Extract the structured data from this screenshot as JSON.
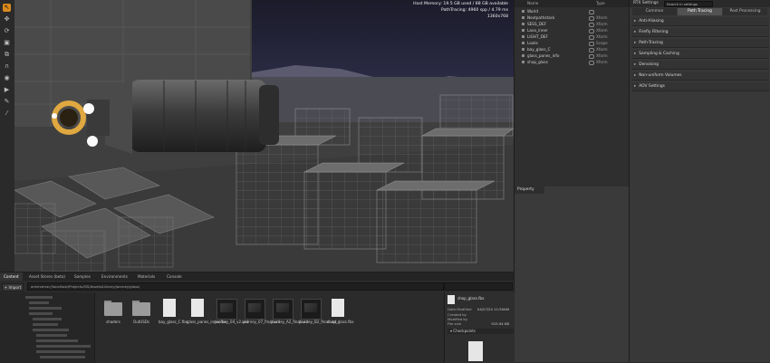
{
  "toolbar": {
    "tools": [
      {
        "name": "select-tool-icon",
        "glyph": "↖",
        "active": true
      },
      {
        "name": "move-tool-icon",
        "glyph": "✥",
        "active": false
      },
      {
        "name": "rotate-tool-icon",
        "glyph": "⟳",
        "active": false
      },
      {
        "name": "scale-tool-icon",
        "glyph": "▣",
        "active": false
      },
      {
        "name": "snap-tool-icon",
        "glyph": "⧉",
        "active": false
      },
      {
        "name": "magnet-tool-icon",
        "glyph": "∩",
        "active": false
      },
      {
        "name": "camera-tool-icon",
        "glyph": "◉",
        "active": false
      },
      {
        "name": "play-tool-icon",
        "glyph": "▶",
        "active": false
      },
      {
        "name": "paint-tool-icon",
        "glyph": "✎",
        "active": false
      },
      {
        "name": "brush-tool-icon",
        "glyph": "⁄",
        "active": false
      }
    ]
  },
  "viewport": {
    "hud_line1": "Host Memory: 19.5 GB used / 88 GB available",
    "hud_line2": "PathTracing: 4960 spp / 4.79 ms",
    "hud_line3": "1360x768"
  },
  "stage": {
    "col_name": "Name",
    "col_type": "Type",
    "rows": [
      {
        "name": "World",
        "type": ""
      },
      {
        "name": "Nextpathstack",
        "type": "Xform"
      },
      {
        "name": "SESS_DEF",
        "type": "Xform"
      },
      {
        "name": "Lava_inner",
        "type": "Xform"
      },
      {
        "name": "LIGHT_DEF",
        "type": "Xform"
      },
      {
        "name": "Looks",
        "type": "Scope"
      },
      {
        "name": "bay_glass_C",
        "type": "Xform"
      },
      {
        "name": "glass_panes_info",
        "type": "Xform"
      },
      {
        "name": "shop_glass",
        "type": "Xform"
      }
    ]
  },
  "property": {
    "tab_label": "Property"
  },
  "settings": {
    "title": "RTX Settings",
    "search_text": "Search in settings",
    "tabs": [
      "Common",
      "Path Tracing",
      "Post Processing"
    ],
    "active_tab": 1,
    "sections": [
      "Anti-Aliasing",
      "Firefly Filtering",
      "Path-Tracing",
      "Sampling & Caching",
      "Denoising",
      "Non-uniform Volumes",
      "AOV Settings"
    ]
  },
  "content": {
    "tabs": [
      "Content",
      "Asset Stores (beta)",
      "Samples",
      "Environments",
      "Materials",
      "Console"
    ],
    "active_tab": 0,
    "import_label": "+ Import",
    "path": "omniverse://localhost/Projects/ISS/Assets/Library/journey/glass/",
    "files": [
      {
        "kind": "folder",
        "label": "shaders"
      },
      {
        "kind": "folder",
        "label": "OutUSDs"
      },
      {
        "kind": "doc",
        "label": "bay_glass_C.fbx"
      },
      {
        "kind": "doc",
        "label": "glass_panes_inner.fbx"
      },
      {
        "kind": "img",
        "label": "journey_04_v2.usd"
      },
      {
        "kind": "img",
        "label": "journey_07_final.usd"
      },
      {
        "kind": "img",
        "label": "journey_A2_final.usd"
      },
      {
        "kind": "img",
        "label": "journey_B2_final.usd"
      },
      {
        "kind": "doc",
        "label": "shop_glass.fbx"
      }
    ],
    "detail": {
      "filename": "shop_glass.fbx",
      "date_modified_label": "Date Modified",
      "date_modified": "04/27/24 11:50AM",
      "created_by_label": "Created by",
      "modified_by_label": "Modified by",
      "size_label": "File size",
      "size": "915.94 KB",
      "checkpoints_label": "Checkpoints"
    }
  }
}
